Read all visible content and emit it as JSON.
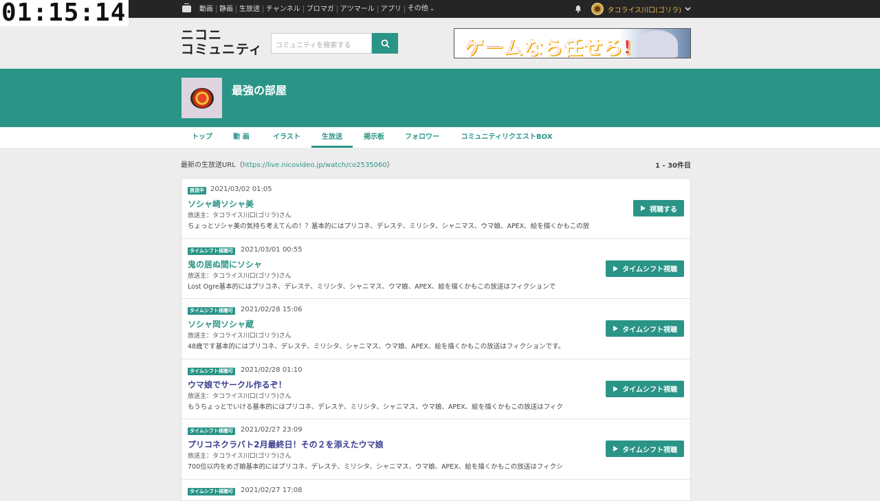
{
  "overlay": {
    "timer": "01:15:14"
  },
  "topbar": {
    "nav": [
      "動画",
      "静画",
      "生放送",
      "チャンネル",
      "ブロマガ",
      "アツマール",
      "アプリ",
      "その他"
    ],
    "more_chevron": "⌄",
    "user_name": "タコライス川口(ゴリラ)",
    "icons": [
      "tv-icon",
      "bell-icon",
      "chevron-down-icon"
    ]
  },
  "header": {
    "logo_line1": "ニコニ",
    "logo_line2": "コミュニティ",
    "search_placeholder": "コミュニティを検索する",
    "banner_text": "ゲームなら任せろ!"
  },
  "community": {
    "title": "最強の部屋"
  },
  "tabs": [
    {
      "label": "トップ"
    },
    {
      "label": "動 画"
    },
    {
      "label": "イラスト"
    },
    {
      "label": "生放送"
    },
    {
      "label": "掲示板"
    },
    {
      "label": "フォロワー"
    },
    {
      "label": "コミュニティリクエストBOX"
    }
  ],
  "main": {
    "latest_label": "最新の生放送URL（",
    "latest_url": "https://live.nicovideo.jp/watch/co2535060",
    "latest_close": "）",
    "count": "1 - 30件目"
  },
  "broadcasts": [
    {
      "badge": "放送中",
      "date": "2021/03/02 01:05",
      "title": "ソシャ崎ソシャ美",
      "host": "放送主：タコライス川口(ゴリラ)さん",
      "desc": "ちょっとソシャ美の気持ち考えてんの！？基本的にはプリコネ、デレステ、ミリシタ、シャニマス、ウマ娘、APEX、絵を描くかもこの放",
      "button": "視聴する"
    },
    {
      "badge": "タイムシフト視聴可",
      "date": "2021/03/01 00:55",
      "title": "鬼の居ぬ間にソシャ",
      "host": "放送主：タコライス川口(ゴリラ)さん",
      "desc": "Lost Ogre基本的にはプリコネ、デレステ、ミリシタ、シャニマス、ウマ娘、APEX、絵を描くかもこの放送はフィクションで",
      "button": "タイムシフト視聴"
    },
    {
      "badge": "タイムシフト視聴可",
      "date": "2021/02/28 15:06",
      "title": "ソシャ岡ソシャ蔵",
      "host": "放送主：タコライス川口(ゴリラ)さん",
      "desc": "48歳です基本的にはプリコネ、デレステ、ミリシタ、シャニマス、ウマ娘、APEX、絵を描くかもこの放送はフィクションです。",
      "button": "タイムシフト視聴"
    },
    {
      "badge": "タイムシフト視聴可",
      "date": "2021/02/28 01:10",
      "title": "ウマ娘でサークル作るぞ！",
      "host": "放送主：タコライス川口(ゴリラ)さん",
      "desc": "もうちょっとでいける基本的にはプリコネ、デレステ、ミリシタ、シャニマス、ウマ娘、APEX、絵を描くかもこの放送はフィク",
      "button": "タイムシフト視聴"
    },
    {
      "badge": "タイムシフト視聴可",
      "date": "2021/02/27 23:09",
      "title": "プリコネクラバト2月最終日！その２を添えたウマ娘",
      "host": "放送主：タコライス川口(ゴリラ)さん",
      "desc": "700位以内をめざ娘基本的にはプリコネ、デレステ、ミリシタ、シャニマス、ウマ娘、APEX、絵を描くかもこの放送はフィクシ",
      "button": "タイムシフト視聴"
    },
    {
      "badge": "タイムシフト視聴可",
      "date": "2021/02/27 17:08"
    }
  ],
  "colors": {
    "accent": "#2a9487",
    "visited": "#3a3d8f",
    "topbar": "#252525",
    "user": "#e8b94a"
  }
}
